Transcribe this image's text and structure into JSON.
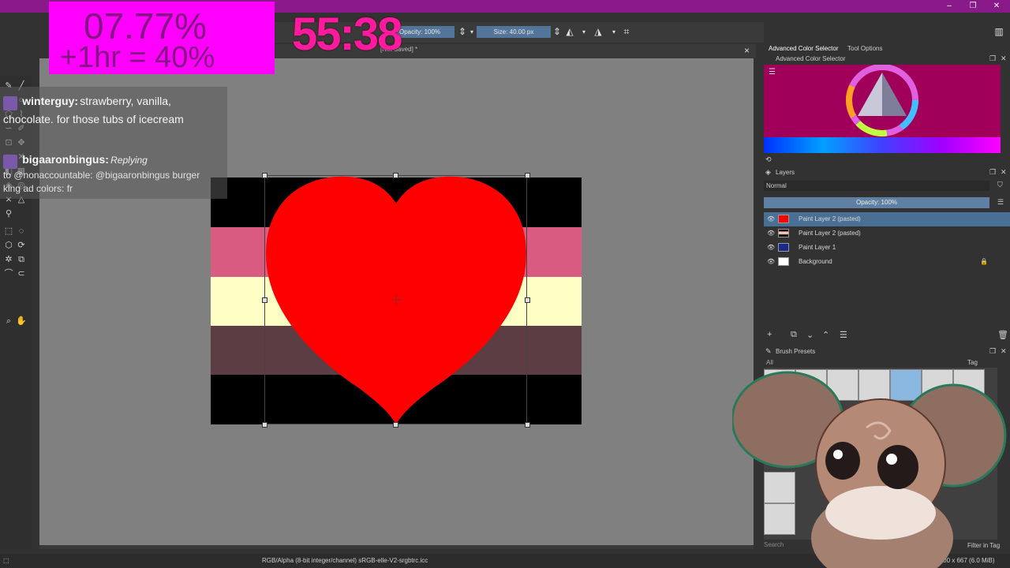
{
  "window": {
    "minimize_icon": "minimize-icon",
    "maximize_icon": "restore-icon",
    "close_icon": "close-icon"
  },
  "toolbar": {
    "opacity_label": "Opacity: 100%",
    "size_label": "Size: 40.00 px",
    "mirror_icon": "mirror-icon",
    "flip_icon": "flip-icon",
    "wrap_icon": "crop-icon"
  },
  "document": {
    "tab_title": "[Not Saved] *",
    "close_label": "×"
  },
  "overlay": {
    "progress_line1": "07.77%",
    "progress_line2": "+1hr = 40%",
    "timer": "55:38"
  },
  "chat": [
    {
      "badge": "2",
      "user": "winterguy:",
      "message": "strawberry, vanilla, chocolate. for those tubs of icecream"
    },
    {
      "user": "bigaaronbingus:",
      "reply_prefix": "Replying",
      "reply_line": "to @nonaccountable: @bigaaronbingus burger",
      "reply_line2": "king ad colors:",
      "message": "fr"
    }
  ],
  "canvas": {
    "flag_colors": [
      "#000000",
      "#d95b82",
      "#fffec4",
      "#5d3d44",
      "#000000"
    ],
    "heart_color": "#ff0000"
  },
  "right_dock": {
    "tabs": [
      "Advanced Color Selector",
      "Tool Options"
    ],
    "color_panel_title": "Advanced Color Selector",
    "layers_title": "Layers",
    "blend_mode": "Normal",
    "layer_opacity": "Opacity: 100%",
    "layers": [
      {
        "name": "Paint Layer 2 (pasted)",
        "thumb": "#ff0000",
        "selected": true
      },
      {
        "name": "Paint Layer 2 (pasted)",
        "thumb": "#d95b82",
        "selected": false
      },
      {
        "name": "Paint Layer 1",
        "thumb": "#1a2a8a",
        "selected": false
      },
      {
        "name": "Background",
        "thumb": "#ffffff",
        "selected": false
      }
    ],
    "brush_presets_title": "Brush Presets",
    "brush_filter_all": "All",
    "brush_tag_label": "Tag",
    "brush_search_placeholder": "Search",
    "filter_in_tag": "Filter in Tag"
  },
  "status": {
    "color_profile": "RGB/Alpha (8-bit integer/channel)  sRGB-elle-V2-srgbtrc.icc",
    "image_size": "1,000 x 667 (6.0 MiB)"
  },
  "accent_color": "#ff00ff",
  "selection_color": "#4a6f94"
}
